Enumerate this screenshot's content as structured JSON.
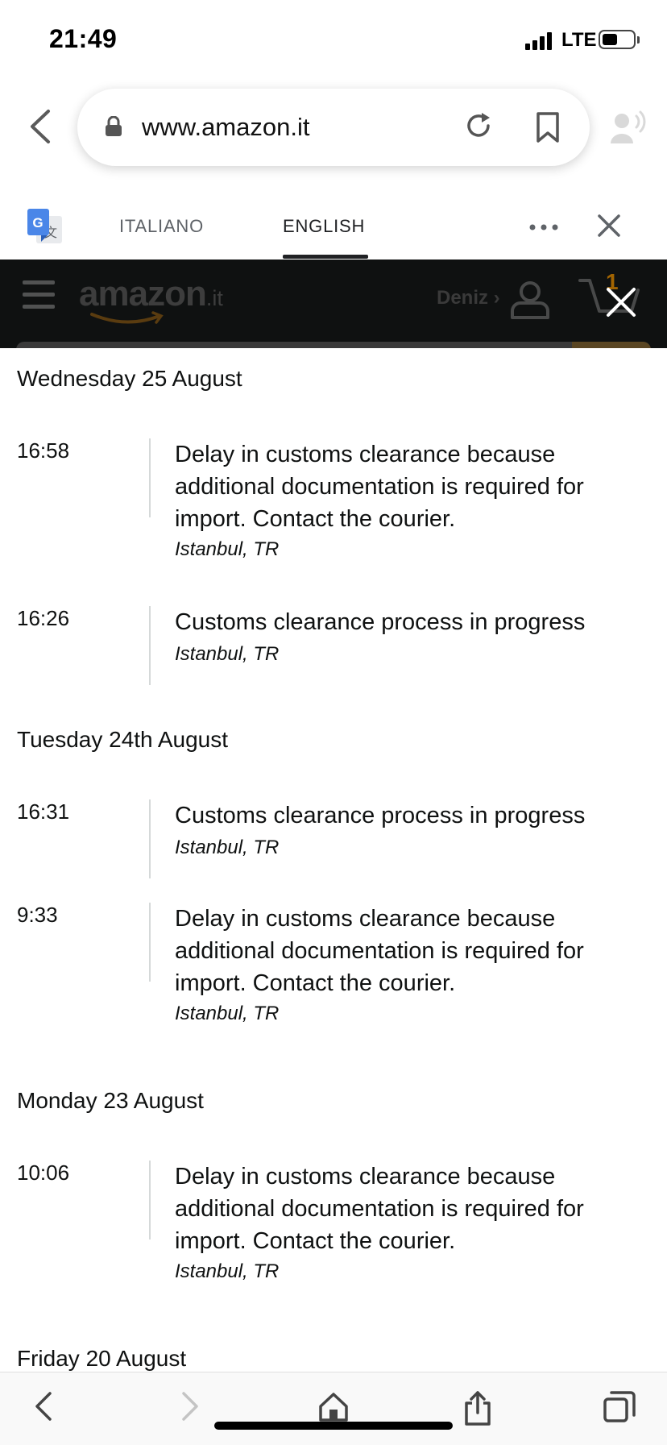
{
  "status_bar": {
    "time": "21:49",
    "network": "LTE",
    "battery_level": 0.5
  },
  "browser": {
    "url": "www.amazon.it"
  },
  "translate_bar": {
    "tab_italiano": "ITALIANO",
    "tab_english": "ENGLISH",
    "active_tab": "ENGLISH"
  },
  "amazon_header": {
    "logo": "amazon",
    "tld": ".it",
    "account_name": "Deniz ›",
    "cart_count": "1"
  },
  "tracking": {
    "days": [
      {
        "label": "Wednesday 25 August",
        "events": [
          {
            "time": "16:58",
            "description": "Delay in customs clearance because additional documentation is required for import. Contact the courier.",
            "location": "Istanbul, TR"
          },
          {
            "time": "16:26",
            "description": "Customs clearance process in progress",
            "location": "Istanbul, TR"
          }
        ]
      },
      {
        "label": "Tuesday 24th August",
        "events": [
          {
            "time": "16:31",
            "description": "Customs clearance process in progress",
            "location": "Istanbul, TR"
          },
          {
            "time": "9:33",
            "description": "Delay in customs clearance because additional documentation is required for import. Contact the courier.",
            "location": "Istanbul, TR"
          }
        ]
      },
      {
        "label": "Monday 23 August",
        "events": [
          {
            "time": "10:06",
            "description": "Delay in customs clearance because additional documentation is required for import. Contact the courier.",
            "location": "Istanbul, TR"
          }
        ]
      },
      {
        "label": "Friday 20 August",
        "events": []
      }
    ]
  },
  "icons": {
    "back": "chevron-left-icon",
    "lock": "lock-icon",
    "reload": "reload-icon",
    "bookmark": "bookmark-icon",
    "speaker": "speaker-icon",
    "translate": "google-translate-icon",
    "more": "more-icon",
    "close": "close-icon",
    "toolbar": [
      "back-icon",
      "forward-icon",
      "home-icon",
      "share-icon",
      "tabs-icon"
    ]
  },
  "colors": {
    "amazon_bar": "#0f1111",
    "text": "#0f1111",
    "divider": "#d5d9d9"
  }
}
